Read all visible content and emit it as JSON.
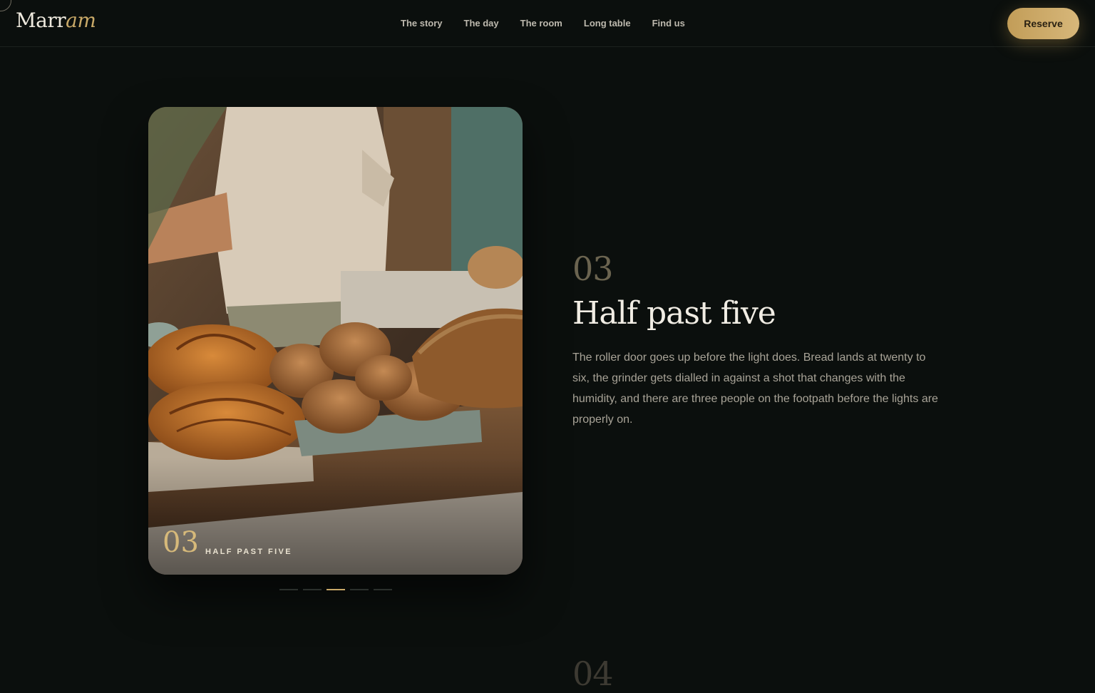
{
  "brand": {
    "name_plain": "Marr",
    "name_italic": "am"
  },
  "nav": {
    "items": [
      {
        "label": "The story"
      },
      {
        "label": "The day"
      },
      {
        "label": "The room"
      },
      {
        "label": "Long table"
      },
      {
        "label": "Find us"
      }
    ]
  },
  "header": {
    "reserve_label": "Reserve"
  },
  "gallery": {
    "image_subject": "bakery counter with croissants, seeded buns and loaf",
    "card_number": "03",
    "card_caption": "HALF PAST FIVE",
    "indicator_count": 5,
    "active_indicator": 3
  },
  "step": {
    "number": "03",
    "title": "Half past five",
    "body": "The roller door goes up before the light does. Bread lands at twenty to six, the grinder gets dialled in against a shot that changes with the humidity, and there are three people on the footpath before the lights are properly on."
  },
  "next_step": {
    "number": "04"
  },
  "colors": {
    "background": "#0b0f0d",
    "accent_gold": "#c9a968",
    "text": "#f1ede4",
    "muted": "#a8a397"
  }
}
